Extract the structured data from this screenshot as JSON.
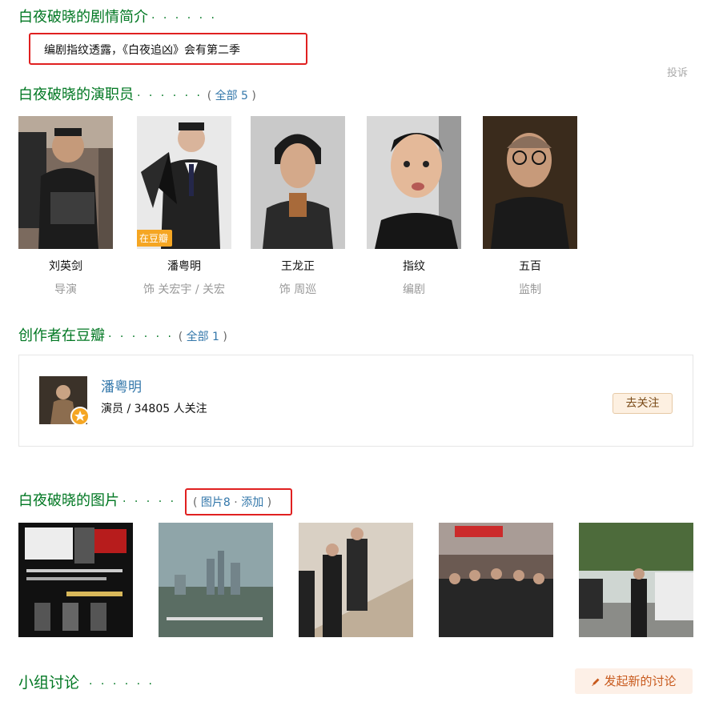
{
  "summary": {
    "title": "白夜破晓的剧情简介",
    "dots": "· · · · · ·",
    "text": "编剧指纹透露，《白夜追凶》会有第二季",
    "report_label": "投诉"
  },
  "cast": {
    "title": "白夜破晓的演职员",
    "dots": "· · · · · ·",
    "link_prefix": "(",
    "link_text": "全部 5",
    "link_suffix": ")",
    "people": [
      {
        "name": "刘英剑",
        "role": "导演",
        "badge": ""
      },
      {
        "name": "潘粤明",
        "role": "饰 关宏宇 / 关宏",
        "badge": "在豆瓣"
      },
      {
        "name": "王龙正",
        "role": "饰 周巡",
        "badge": ""
      },
      {
        "name": "指纹",
        "role": "编剧",
        "badge": ""
      },
      {
        "name": "五百",
        "role": "监制",
        "badge": ""
      }
    ]
  },
  "creators": {
    "title": "创作者在豆瓣",
    "dots": "· · · · · ·",
    "link_prefix": "(",
    "link_text": "全部 1",
    "link_suffix": ")",
    "name": "潘粤明",
    "meta": "演员 / 34805 人关注",
    "follow_label": "去关注"
  },
  "photos": {
    "title": "白夜破晓的图片",
    "dots": "· · · · ·",
    "link_prefix": "(",
    "link_count": "图片8",
    "link_sep": "·",
    "link_add": "添加",
    "link_suffix": ")"
  },
  "group": {
    "title": "小组讨论",
    "dots": "· · · · · ·",
    "new_discussion_label": "发起新的讨论"
  },
  "colors": {
    "section_title": "#007722",
    "link": "#3377aa",
    "highlight_box": "#e02020",
    "badge": "#f5a623"
  }
}
